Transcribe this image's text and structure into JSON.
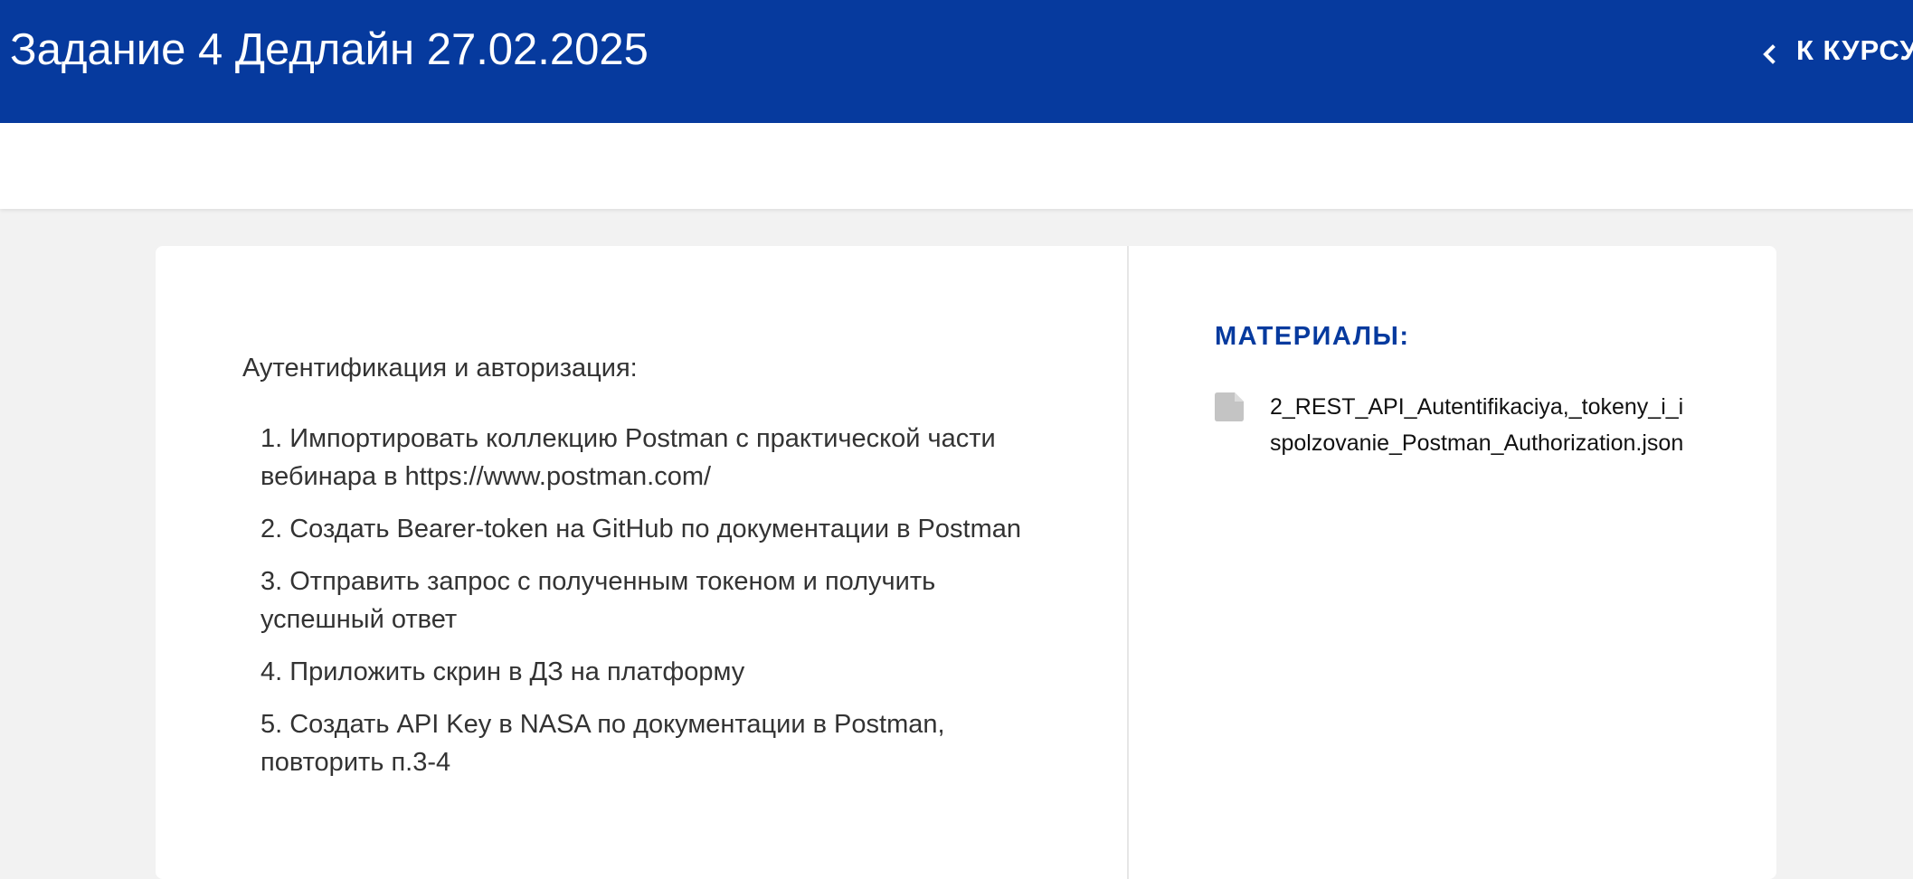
{
  "header": {
    "title": "Задание 4 Дедлайн 27.02.2025",
    "back_label": "К КУРСУ",
    "back_icon": "chevron-left-icon",
    "background_color": "#063a9e"
  },
  "task": {
    "intro": "Аутентификация и авторизация:",
    "steps": [
      "1. Импортировать коллекцию Postman с практической части вебинара в https://www.postman.com/",
      "2. Создать Bearer-token на GitHub по документации в Postman",
      "3. Отправить запрос с полученным токеном и получить успешный ответ",
      "4. Приложить скрин в ДЗ на платформу",
      "5. Создать API Key в NASA по документации в Postman, повторить п.3-4"
    ]
  },
  "materials": {
    "title": "МАТЕРИАЛЫ:",
    "files": [
      {
        "icon": "file-icon",
        "name": "2_REST_API_Autentifikaciya,_tokeny_i_ispolzovanie_Postman_Authorization.json"
      }
    ]
  },
  "colors": {
    "accent": "#063a9e",
    "page_background": "#f2f2f2",
    "card_background": "#ffffff",
    "file_icon": "#c4c4c4"
  }
}
